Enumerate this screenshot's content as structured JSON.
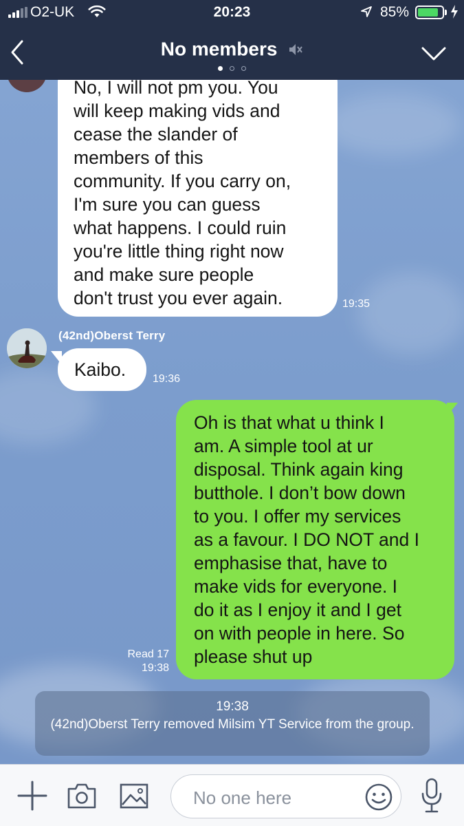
{
  "status_bar": {
    "carrier": "O2-UK",
    "time": "20:23",
    "battery": "85%",
    "battery_level": 0.85
  },
  "header": {
    "title": "No members",
    "muted": true,
    "page_dots": 3,
    "active_dot": 0
  },
  "messages": [
    {
      "direction": "incoming",
      "text": "No, I will not pm you. You\nwill keep making vids and\ncease the slander of\nmembers of this\ncommunity. If you carry on,\nI'm sure you can guess\nwhat happens. I could ruin\nyou're little thing right now\nand make sure people\ndon't trust you ever again.",
      "time": "19:35"
    },
    {
      "direction": "incoming",
      "sender": "(42nd)Oberst Terry",
      "text": "Kaibo.",
      "time": "19:36"
    },
    {
      "direction": "outgoing",
      "text": "Oh is that what u think I\nam. A simple tool at ur\ndisposal. Think again king\nbutthole. I don’t bow down\nto you. I offer my services\nas a favour. I DO NOT and I\nemphasise that, have to\nmake vids for everyone. I\ndo it as I enjoy it and I get\non with people in here. So\nplease shut up",
      "read": "Read 17",
      "time": "19:38"
    }
  ],
  "system_notice": {
    "time": "19:38",
    "text": "(42nd)Oberst Terry removed Milsim YT Service from the group."
  },
  "input_bar": {
    "placeholder": "No one here",
    "icons": [
      "plus-icon",
      "camera-icon",
      "image-icon",
      "emoji-icon",
      "microphone-icon"
    ]
  },
  "colors": {
    "header_bg": "#253048",
    "outgoing_bubble": "#85e24b",
    "incoming_bubble": "#ffffff",
    "chat_bg": "#7f9fce",
    "battery_fill": "#4cd964"
  }
}
